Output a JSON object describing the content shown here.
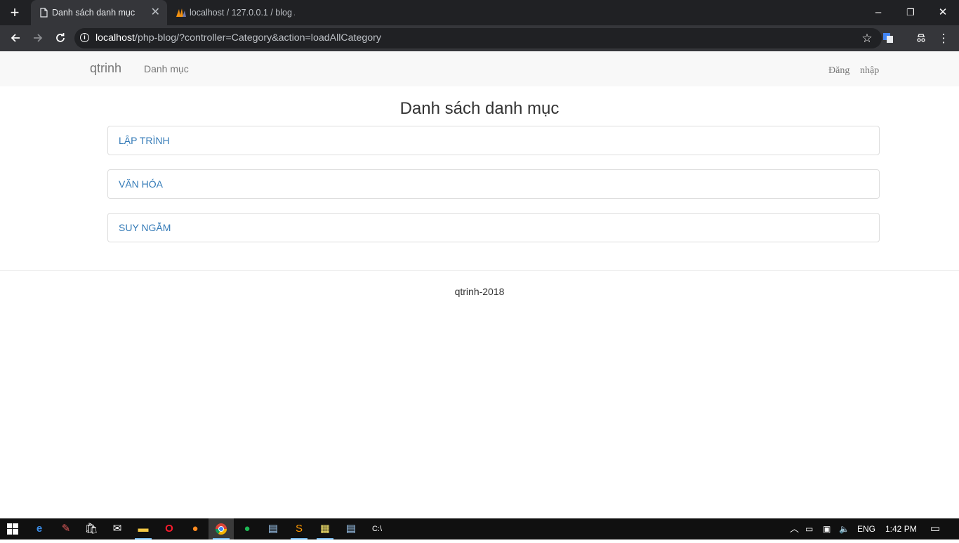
{
  "browser": {
    "new_tab_icon": "+",
    "tabs": [
      {
        "title": "Danh sách danh mục",
        "icon": "page-icon",
        "close": "✕"
      },
      {
        "title": "localhost / 127.0.0.1 / blog /",
        "icon": "phpmyadmin-icon"
      }
    ],
    "window_controls": {
      "minimize": "–",
      "restore": "❐",
      "close": "✕"
    },
    "url": {
      "host": "localhost",
      "path": "/php-blog/?controller=Category&action=loadAllCategory"
    }
  },
  "page": {
    "navbar": {
      "brand": "qtrinh",
      "link": "Danh mục",
      "login_1": "Đăng",
      "login_2": "nhập"
    },
    "title": "Danh sách danh mục",
    "categories": [
      "LẬP TRÌNH",
      "VĂN HÓA",
      "SUY NGẪM"
    ],
    "footer": "qtrinh-2018"
  },
  "taskbar": {
    "language": "ENG",
    "time": "1:42 PM"
  }
}
